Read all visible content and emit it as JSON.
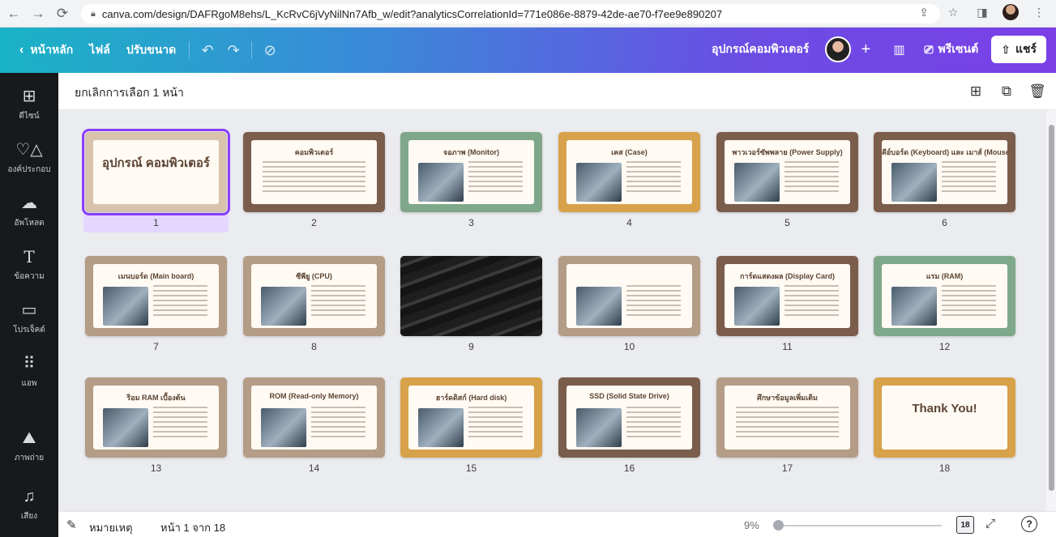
{
  "browser": {
    "url": "canva.com/design/DAFRgoM8ehs/L_KcRvC6jVyNilNn7Afb_w/edit?analyticsCorrelationId=771e086e-8879-42de-ae70-f7ee9e890207"
  },
  "topbar": {
    "home_label": "หน้าหลัก",
    "file_label": "ไฟล์",
    "resize_label": "ปรับขนาด",
    "doc_title": "อุปกรณ์คอมพิวเตอร์",
    "present_label": "พรีเซนต์",
    "share_label": "แชร์"
  },
  "sidebar": {
    "items": [
      {
        "label": "ดีไซน์",
        "icon": "layout-icon"
      },
      {
        "label": "องค์ประกอบ",
        "icon": "shapes-icon"
      },
      {
        "label": "อัพโหลด",
        "icon": "cloud-upload-icon"
      },
      {
        "label": "ข้อความ",
        "icon": "text-icon"
      },
      {
        "label": "โปรเจ็คต์",
        "icon": "folder-icon"
      },
      {
        "label": "แอพ",
        "icon": "apps-icon"
      },
      {
        "label": "ภาพถ่าย",
        "icon": "photo-icon"
      },
      {
        "label": "เสียง",
        "icon": "music-icon"
      }
    ]
  },
  "main": {
    "deselect_label": "ยกเลิกการเลือก 1 หน้า"
  },
  "slides": [
    {
      "num": "1",
      "title": "อุปกรณ์ คอมพิวเตอร์",
      "bg": "#d8c2ad",
      "selected": true
    },
    {
      "num": "2",
      "title": "คอมพิวเตอร์",
      "bg": "#7b5d4b"
    },
    {
      "num": "3",
      "title": "จอภาพ (Monitor)",
      "bg": "#7fa88a"
    },
    {
      "num": "4",
      "title": "เคส (Case)",
      "bg": "#d7a24a"
    },
    {
      "num": "5",
      "title": "พาวเวอร์ซัพพลาย (Power Supply)",
      "bg": "#7b5d4b"
    },
    {
      "num": "6",
      "title": "คีย์บอร์ด (Keyboard) และ เมาส์ (Mouse)",
      "bg": "#7b5d4b"
    },
    {
      "num": "7",
      "title": "เมนบอร์ด (Main board)",
      "bg": "#b59c86"
    },
    {
      "num": "8",
      "title": "ซีพียู (CPU)",
      "bg": "#b59c86"
    },
    {
      "num": "9",
      "title": "",
      "bg": "#2a2a2a",
      "photo": true
    },
    {
      "num": "10",
      "title": "",
      "bg": "#b59c86"
    },
    {
      "num": "11",
      "title": "การ์ดแสดงผล (Display Card)",
      "bg": "#7b5d4b"
    },
    {
      "num": "12",
      "title": "แรม (RAM)",
      "bg": "#7fa88a"
    },
    {
      "num": "13",
      "title": "ริอม RAM เบื้องต้น",
      "bg": "#b59c86"
    },
    {
      "num": "14",
      "title": "ROM (Read-only Memory)",
      "bg": "#b59c86"
    },
    {
      "num": "15",
      "title": "ฮาร์ดดิสก์ (Hard disk)",
      "bg": "#d7a24a"
    },
    {
      "num": "16",
      "title": "SSD (Solid State Drive)",
      "bg": "#7b5d4b"
    },
    {
      "num": "17",
      "title": "ศึกษาข้อมูลเพิ่มเติม",
      "bg": "#b59c86"
    },
    {
      "num": "18",
      "title": "Thank You!",
      "bg": "#d7a24a"
    }
  ],
  "bottombar": {
    "notes_label": "หมายเหตุ",
    "page_info": "หน้า 1 จาก 18",
    "zoom": "9%",
    "grid_count": "18",
    "help": "?"
  }
}
